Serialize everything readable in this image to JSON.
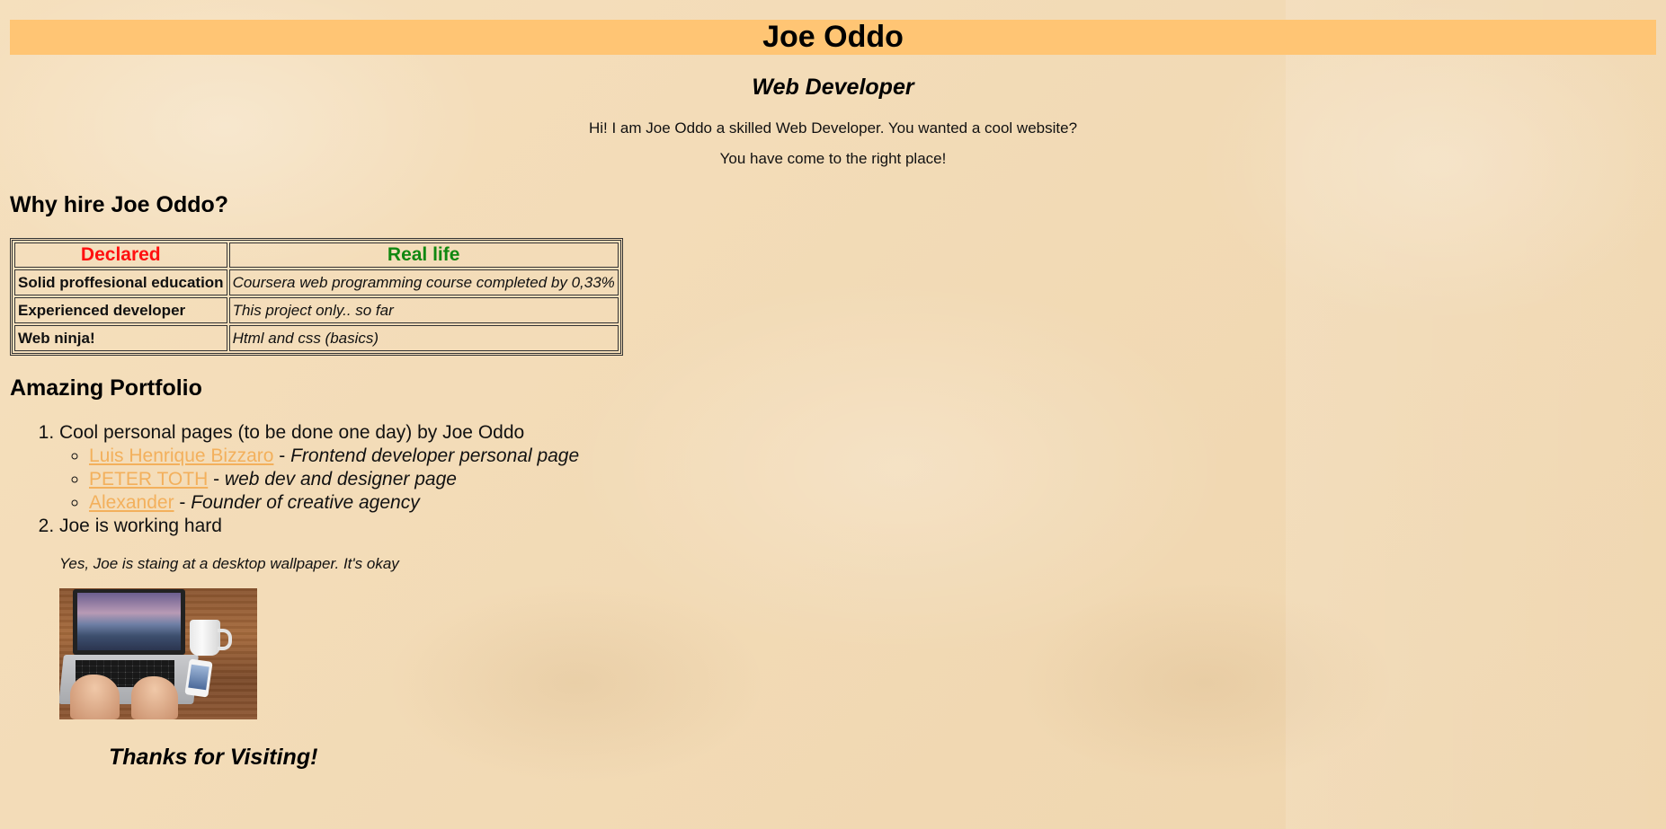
{
  "header": {
    "title": "Joe Oddo"
  },
  "hero": {
    "subtitle": "Web Developer",
    "intro_line1": "Hi! I am Joe Oddo a skilled Web Developer. You wanted a cool website?",
    "intro_line2": "You have come to the right place!"
  },
  "why": {
    "heading": "Why hire Joe Oddo?",
    "col_declared": "Declared",
    "col_real": "Real life",
    "rows": [
      {
        "label": "Solid proffesional education",
        "value": "Coursera web programming course completed by 0,33%"
      },
      {
        "label": "Experienced developer",
        "value": "This project only.. so far"
      },
      {
        "label": "Web ninja!",
        "value": "Html and css (basics)"
      }
    ],
    "colors": {
      "declared": "#ff1010",
      "real": "#118811"
    }
  },
  "portfolio": {
    "heading": "Amazing Portfolio",
    "items": [
      {
        "text": "Cool personal pages (to be done one day) by Joe Oddo",
        "links": [
          {
            "name": "Luis Henrique Bizzaro",
            "sep": " - ",
            "desc": "Frontend developer personal page"
          },
          {
            "name": "PETER TOTH",
            "sep": " - ",
            "desc": "web dev and designer page"
          },
          {
            "name": "Alexander",
            "sep": " - ",
            "desc": "Founder of creative agency"
          }
        ]
      },
      {
        "text": "Joe is working hard",
        "note": "Yes, Joe is staing at a desktop wallpaper. It's okay"
      }
    ]
  },
  "footer": {
    "thanks": "Thanks for Visiting!"
  },
  "colors": {
    "header_bar": "#ffc574",
    "link": "#f3b05c",
    "background": "#f4dcb6"
  }
}
